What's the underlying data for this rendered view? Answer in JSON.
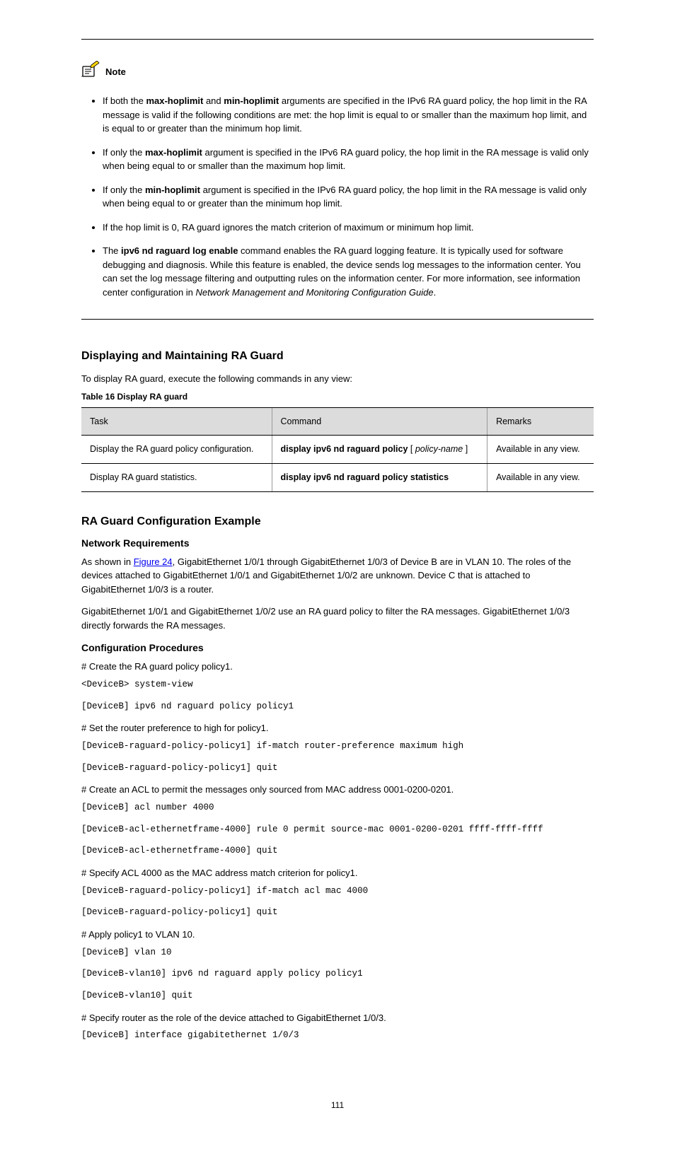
{
  "note": {
    "label": "Note",
    "items": [
      {
        "pre": "If both the ",
        "b1": "max-hoplimit",
        "mid1": " and ",
        "b2": "min-hoplimit",
        "post": " arguments are specified in the IPv6 RA guard policy, the hop limit in the RA message is valid if the following conditions are met: the hop limit is equal to or smaller than the maximum hop limit, and is equal to or greater than the minimum hop limit."
      },
      {
        "pre": "If only the ",
        "b1": "max-hoplimit",
        "post": " argument is specified in the IPv6 RA guard policy, the hop limit in the RA message is valid only when being equal to or smaller than the maximum hop limit."
      },
      {
        "pre": "If only the ",
        "b1": "min-hoplimit",
        "post": " argument is specified in the IPv6 RA guard policy, the hop limit in the RA message is valid only when being equal to or greater than the minimum hop limit."
      },
      {
        "pre": "If the hop limit is 0, RA guard ignores the match criterion of maximum or minimum hop limit."
      },
      {
        "pre": "The ",
        "b1": "ipv6 nd raguard log enable",
        "post": " command enables the RA guard logging feature. It is typically used for software debugging and diagnosis. While this feature is enabled, the device sends log messages to the information center. You can set the log message filtering and outputting rules on the information center. For more information, see information center configuration in ",
        "italic": "Network Management and Monitoring Configuration Guide",
        "tail": "."
      }
    ]
  },
  "display": {
    "title": "Displaying and Maintaining RA Guard",
    "intro": "To display RA guard, execute the following commands in any view:",
    "table_caption": "Table 16 Display RA guard",
    "headers": [
      "Task",
      "Command",
      "Remarks"
    ],
    "rows": [
      {
        "task_pre": "Display the RA guard policy configuration.",
        "command_pre": "display ipv6 nd raguard policy",
        "command_arg": " [ ",
        "command_italic": "policy-name",
        "command_arg2": " ]",
        "remarks": "Available in any view."
      },
      {
        "task_pre": "Display RA guard statistics.",
        "command_pre": "display ipv6 nd raguard policy statistics",
        "remarks": "Available in any view."
      }
    ]
  },
  "example": {
    "title": "RA Guard Configuration Example",
    "nr_title": "Network Requirements",
    "nr_text_1_pre": "As shown in ",
    "nr_link": "Figure 24",
    "nr_text_1_post": ", GigabitEthernet 1/0/1 through GigabitEthernet 1/0/3 of Device B are in VLAN 10. The roles of the devices attached to GigabitEthernet 1/0/1 and GigabitEthernet 1/0/2 are unknown. Device C that is attached to GigabitEthernet 1/0/3 is a router.",
    "nr_text_2": "GigabitEthernet 1/0/1 and GigabitEthernet 1/0/2 use an RA guard policy to filter the RA messages. GigabitEthernet 1/0/3 directly forwards the RA messages.",
    "cp_title": "Configuration Procedures",
    "steps": [
      "# Create the RA guard policy policy1.",
      {
        "code": "<DeviceB> system-view"
      },
      {
        "code": "[DeviceB] ipv6 nd raguard policy policy1"
      },
      "# Set the router preference to high for policy1.",
      {
        "code": "[DeviceB-raguard-policy-policy1] if-match router-preference maximum high"
      },
      {
        "code": "[DeviceB-raguard-policy-policy1] quit"
      },
      "# Create an ACL to permit the messages only sourced from MAC address 0001-0200-0201.",
      {
        "code": "[DeviceB] acl number 4000"
      },
      {
        "code": "[DeviceB-acl-ethernetframe-4000] rule 0 permit source-mac 0001-0200-0201 ffff-ffff-ffff"
      },
      {
        "code": "[DeviceB-acl-ethernetframe-4000] quit"
      },
      "# Specify ACL 4000 as the MAC address match criterion for policy1.",
      {
        "code": "[DeviceB-raguard-policy-policy1] if-match acl mac 4000"
      },
      {
        "code": "[DeviceB-raguard-policy-policy1] quit"
      },
      "# Apply policy1 to VLAN 10.",
      {
        "code": "[DeviceB] vlan 10"
      },
      {
        "code": "[DeviceB-vlan10] ipv6 nd raguard apply policy policy1"
      },
      {
        "code": "[DeviceB-vlan10] quit"
      },
      "# Specify router as the role of the device attached to GigabitEthernet 1/0/3.",
      {
        "code": "[DeviceB] interface gigabitethernet 1/0/3"
      }
    ]
  },
  "page_number": "111"
}
